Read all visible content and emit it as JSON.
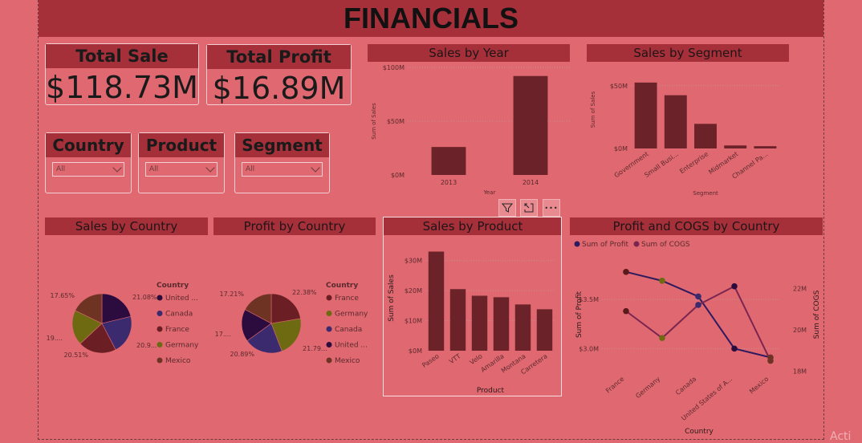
{
  "title": "FINANCIALS",
  "kpis": [
    {
      "label": "Total Sale",
      "value": "$118.73M"
    },
    {
      "label": "Total Profit",
      "value": "$16.89M"
    }
  ],
  "slicers": [
    {
      "label": "Country",
      "value": "All"
    },
    {
      "label": "Product",
      "value": "All"
    },
    {
      "label": "Segment",
      "value": "All"
    }
  ],
  "visual_toolbar": {
    "filter_icon": "filter-icon",
    "focus_icon": "focus-mode-icon",
    "more_label": "•••"
  },
  "watermark": "Acti",
  "colors": {
    "bar": "#6b2228",
    "title_bg": "#a5303a",
    "page_bg": "#e06870"
  },
  "chart_data": [
    {
      "id": "sales_by_year",
      "type": "bar",
      "title": "Sales by Year",
      "xlabel": "Year",
      "ylabel": "Sum of Sales",
      "categories": [
        "2013",
        "2014"
      ],
      "values": [
        26,
        92
      ],
      "unit": "M",
      "yticks": [
        "$0M",
        "$50M",
        "$100M"
      ],
      "ylim": [
        0,
        100
      ]
    },
    {
      "id": "sales_by_segment",
      "type": "bar",
      "title": "Sales by Segment",
      "xlabel": "Segment",
      "ylabel": "Sum of Sales",
      "categories": [
        "Government",
        "Small Busi...",
        "Enterprise",
        "Midmarket",
        "Channel Pa..."
      ],
      "values": [
        52.5,
        42.4,
        19.6,
        2.4,
        1.8
      ],
      "unit": "M",
      "yticks": [
        "$0M",
        "$50M"
      ],
      "ylim": [
        0,
        62
      ]
    },
    {
      "id": "sales_by_country",
      "type": "pie",
      "title": "Sales by Country",
      "legend_title": "Country",
      "legend": [
        "United ...",
        "Canada",
        "France",
        "Germany",
        "Mexico"
      ],
      "slices": [
        {
          "name": "United States of America",
          "value": 21.08,
          "label": "21.08%",
          "color": "#2c0c3e"
        },
        {
          "name": "Canada",
          "value": 20.9,
          "label": "20.9...",
          "color": "#3b2a6e"
        },
        {
          "name": "France",
          "value": 20.51,
          "label": "20.51%",
          "color": "#6b1e24"
        },
        {
          "name": "Germany",
          "value": 19.0,
          "label": "19....",
          "color": "#6e6a12"
        },
        {
          "name": "Mexico",
          "value": 17.65,
          "label": "17.65%",
          "color": "#6f3324"
        }
      ]
    },
    {
      "id": "profit_by_country",
      "type": "pie",
      "title": "Profit by Country",
      "legend_title": "Country",
      "legend": [
        "France",
        "Germany",
        "Canada",
        "United ...",
        "Mexico"
      ],
      "slices": [
        {
          "name": "France",
          "value": 22.38,
          "label": "22.38%",
          "color": "#6b1e24"
        },
        {
          "name": "Germany",
          "value": 21.79,
          "label": "21.79...",
          "color": "#6e6a12"
        },
        {
          "name": "Canada",
          "value": 20.89,
          "label": "20.89%",
          "color": "#3b2a6e"
        },
        {
          "name": "United States of America",
          "value": 17.73,
          "label": "17....",
          "color": "#2c0c3e"
        },
        {
          "name": "Mexico",
          "value": 17.21,
          "label": "17.21%",
          "color": "#6f3324"
        }
      ]
    },
    {
      "id": "sales_by_product",
      "type": "bar",
      "title": "Sales by Product",
      "xlabel": "Product",
      "ylabel": "Sum of Sales",
      "categories": [
        "Paseo",
        "VTT",
        "Velo",
        "Amarilla",
        "Montana",
        "Carretera"
      ],
      "values": [
        33.0,
        20.5,
        18.3,
        17.8,
        15.4,
        13.8
      ],
      "unit": "M",
      "yticks": [
        "$0M",
        "$10M",
        "$20M",
        "$30M"
      ],
      "ylim": [
        0,
        35
      ]
    },
    {
      "id": "profit_cogs_by_country",
      "type": "line",
      "title": "Profit and COGS by Country",
      "xlabel": "Country",
      "ylabel": "Sum of Profit",
      "y2label": "Sum of COGS",
      "categories": [
        "France",
        "Germany",
        "Canada",
        "United States of A...",
        "Mexico"
      ],
      "series": [
        {
          "name": "Sum of Profit",
          "axis": "left",
          "color": "#2e1a5e",
          "values": [
            3.78,
            3.69,
            3.53,
            3.0,
            2.91
          ]
        },
        {
          "name": "Sum of COGS",
          "axis": "right",
          "color": "#7a2650",
          "values": [
            20.9,
            19.6,
            21.2,
            22.1,
            18.5
          ]
        }
      ],
      "marker_colors": [
        "#5a1a1a",
        "#6e6a12",
        "#3b2a6e",
        "#2c0c3e",
        "#6f3324"
      ],
      "yticks": [
        "$3.0M",
        "$3.5M"
      ],
      "y2ticks": [
        "18M",
        "20M",
        "22M"
      ],
      "ylim": [
        2.75,
        3.95
      ],
      "y2lim": [
        17.9,
        23.6
      ]
    }
  ]
}
